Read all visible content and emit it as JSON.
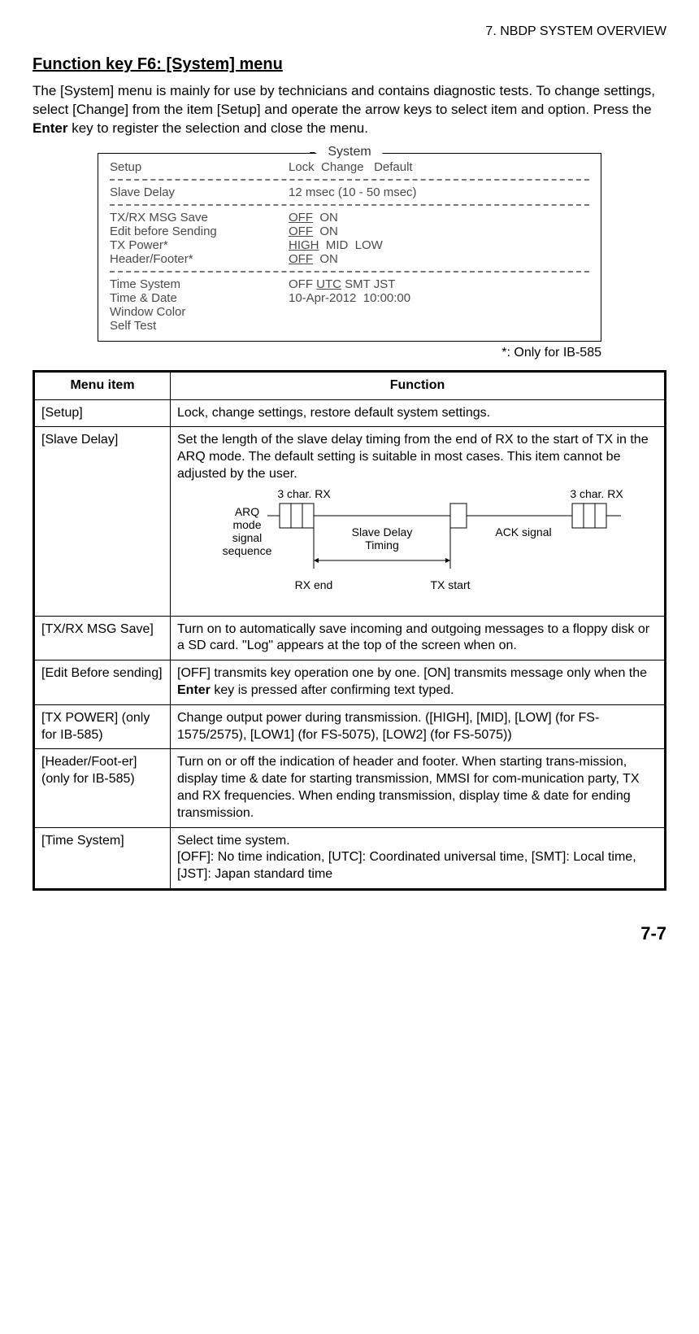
{
  "header": {
    "chapter": "7.  NBDP SYSTEM OVERVIEW"
  },
  "heading": "Function key F6: [System] menu",
  "intro_html": "The [System] menu is mainly for use by technicians and contains diagnostic tests. To change settings, select [Change] from the item [Setup] and operate the arrow keys to select item and option. Press the <b>Enter</b> key to register the selection and close the menu.",
  "system_box": {
    "title": "System",
    "rows": [
      {
        "left": "Setup",
        "right_html": "Lock&nbsp;&nbsp;Change&nbsp;&nbsp;&nbsp;Default",
        "divider_after": true
      },
      {
        "left": "Slave Delay",
        "right_html": "12 msec (10 - 50 msec)",
        "divider_after": true
      },
      {
        "left": "TX/RX MSG Save",
        "right_html": "<span class='underline'>OFF</span>&nbsp;&nbsp;ON"
      },
      {
        "left": "Edit before Sending",
        "right_html": "<span class='underline'>OFF</span>&nbsp;&nbsp;ON"
      },
      {
        "left": "TX Power*",
        "right_html": "<span class='underline'>HIGH</span>&nbsp;&nbsp;MID&nbsp;&nbsp;LOW"
      },
      {
        "left": "Header/Footer*",
        "right_html": "<span class='underline'>OFF</span>&nbsp;&nbsp;ON",
        "divider_after": true
      },
      {
        "left": "Time System",
        "right_html": "OFF <span class='underline'>UTC</span> SMT JST"
      },
      {
        "left": "Time & Date",
        "right_html": "10-Apr-2012&nbsp;&nbsp;10:00:00"
      },
      {
        "left": "Window Color",
        "right_html": ""
      },
      {
        "left": "Self Test",
        "right_html": ""
      }
    ]
  },
  "footnote": "*: Only for IB-585",
  "table": {
    "headers": [
      "Menu item",
      "Function"
    ],
    "rows": [
      {
        "item": "[Setup]",
        "func_html": "Lock, change settings, restore default system settings."
      },
      {
        "item": "[Slave Delay]",
        "func_html": "Set the length of the slave delay timing from the end of RX to the start of TX in the ARQ mode. The default setting is suitable in most cases. This item cannot be adjusted by the user.",
        "diagram": true
      },
      {
        "item": "[TX/RX MSG Save]",
        "func_html": "Turn on to automatically save incoming and outgoing messages to a floppy disk or a SD card. \"Log\" appears at the top of the screen when on."
      },
      {
        "item": "[Edit Before sending]",
        "func_html": "[OFF] transmits key operation one by one. [ON] transmits message only when the <b>Enter</b> key is pressed after confirming text typed."
      },
      {
        "item": "[TX POWER] (only for IB-585)",
        "func_html": "Change output power during transmission. ([HIGH], [MID], [LOW] (for FS-1575/2575), [LOW1] (for FS-5075), [LOW2] (for FS-5075))"
      },
      {
        "item": "[Header/Foot-er] (only for IB-585)",
        "func_html": "Turn on or off the indication of header and footer. When starting trans-mission, display time & date for starting transmission, MMSI for com-munication party, TX and RX frequencies. When ending transmission, display time & date for ending transmission."
      },
      {
        "item": "[Time System]",
        "func_html": "Select time system.<br>[OFF]: No time indication, [UTC]: Coordinated universal time, [SMT]: Local time, [JST]: Japan standard time"
      }
    ]
  },
  "diagram_labels": {
    "arq": "ARQ\nmode\nsignal\nsequence",
    "rx1": "3 char. RX",
    "rx2": "3 char. RX",
    "slave": "Slave Delay\nTiming",
    "ack": "ACK signal",
    "rxend": "RX end",
    "txstart": "TX start"
  },
  "page_number": "7-7"
}
